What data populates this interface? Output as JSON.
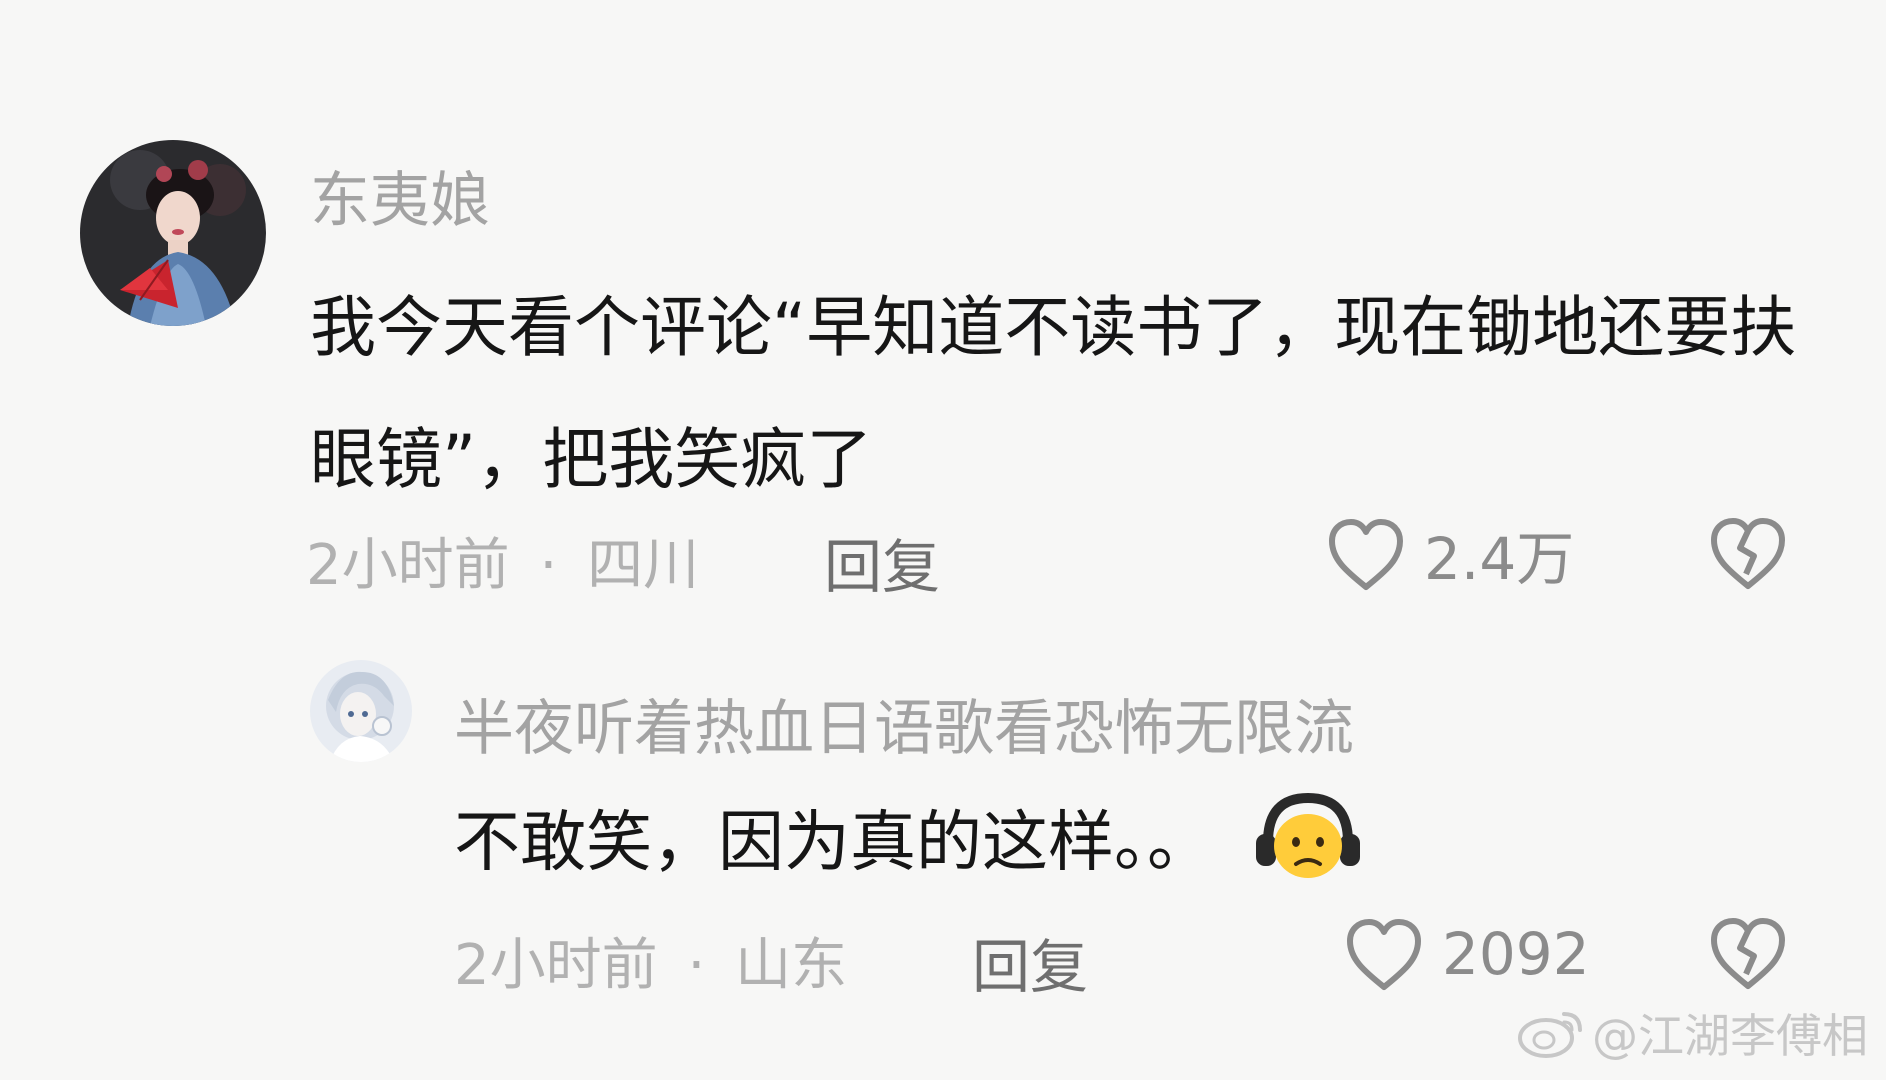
{
  "comments": [
    {
      "username": "东夷娘",
      "text": "我今天看个评论“早知道不读书了，现在锄地还要扶眼镜”，把我笑疯了",
      "time": "2小时前",
      "separator": "·",
      "location": "四川",
      "reply_label": "回复",
      "like_count": "2.4万",
      "avatar_icon": "woman-with-fan-avatar",
      "like_icon": "heart-outline-icon",
      "dislike_icon": "broken-heart-icon"
    },
    {
      "username": "半夜听着热血日语歌看恐怖无限流",
      "text": "不敢笑，因为真的这样。。",
      "emoji_icon": "headphones-face-emoji",
      "time": "2小时前",
      "separator": "·",
      "location": "山东",
      "reply_label": "回复",
      "like_count": "2092",
      "avatar_icon": "anime-girl-avatar",
      "like_icon": "heart-outline-icon",
      "dislike_icon": "broken-heart-icon"
    }
  ],
  "watermark": {
    "text": "@江湖李傅相",
    "icon": "weibo-logo-icon"
  },
  "colors": {
    "background": "#f7f7f6",
    "username": "#a3a3a3",
    "body_text": "#161616",
    "meta_text": "#b1b1b1",
    "icon_gray": "#8b8b8b"
  }
}
